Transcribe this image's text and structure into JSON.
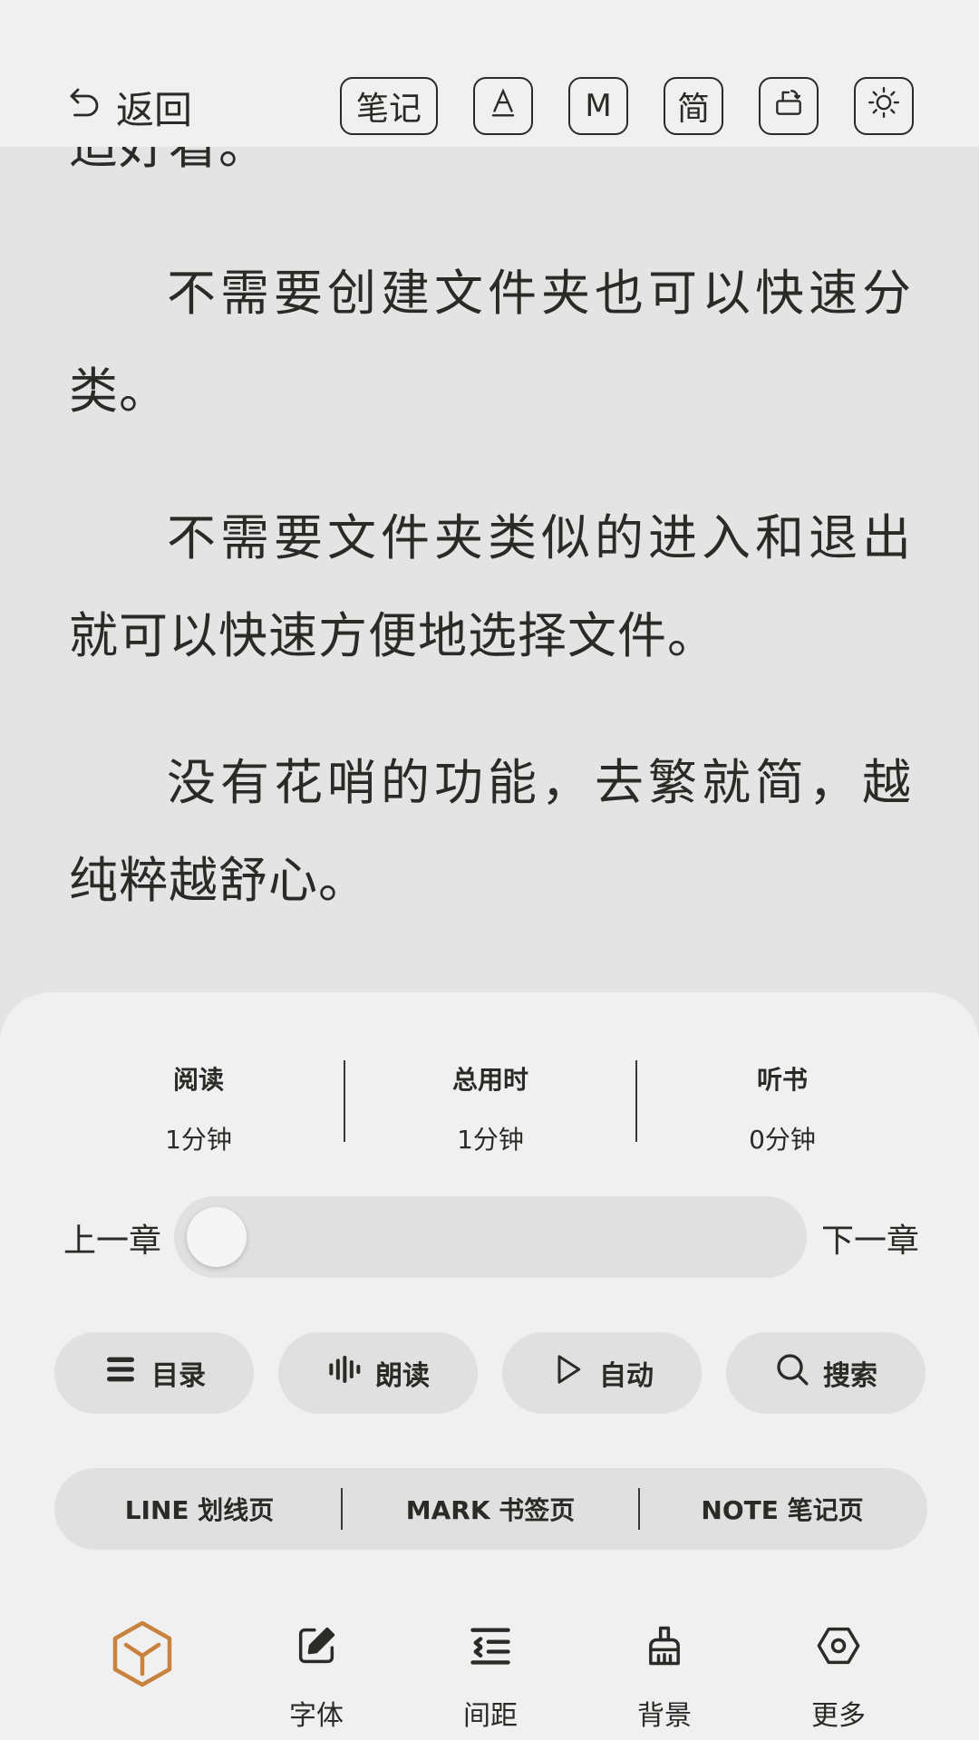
{
  "topbar": {
    "back_label": "返回",
    "note_label": "笔记",
    "m_label": "M",
    "simp_label": "简",
    "icons": [
      "back-arrow-icon",
      "font-a-icon",
      "rotate-icon",
      "brightness-icon"
    ]
  },
  "content": {
    "paragraphs": [
      "适好看。",
      "不需要创建文件夹也可以快速分类。",
      "不需要文件夹类似的进入和退出就可以快速方便地选择文件。",
      "没有花哨的功能，去繁就简，越纯粹越舒心。"
    ]
  },
  "stats": [
    {
      "label": "阅读",
      "value": "1分钟"
    },
    {
      "label": "总用时",
      "value": "1分钟"
    },
    {
      "label": "听书",
      "value": "0分钟"
    }
  ],
  "chapter": {
    "prev_label": "上一章",
    "next_label": "下一章",
    "progress": 0
  },
  "actions": [
    {
      "label": "目录",
      "icon": "list-icon"
    },
    {
      "label": "朗读",
      "icon": "waveform-icon"
    },
    {
      "label": "自动",
      "icon": "play-icon"
    },
    {
      "label": "搜索",
      "icon": "search-icon"
    }
  ],
  "pages": [
    {
      "label": "LINE 划线页"
    },
    {
      "label": "MARK 书签页"
    },
    {
      "label": "NOTE 笔记页"
    }
  ],
  "tabs": [
    {
      "label": "",
      "icon": "app-logo-icon"
    },
    {
      "label": "字体",
      "icon": "edit-icon"
    },
    {
      "label": "间距",
      "icon": "spacing-icon"
    },
    {
      "label": "背景",
      "icon": "brush-icon"
    },
    {
      "label": "更多",
      "icon": "settings-hex-icon"
    }
  ],
  "colors": {
    "accent": "#c9823d",
    "text": "#2b2a26",
    "panel": "#f0f0f0",
    "page": "#e4e4e4",
    "pill": "#e0e0e0"
  }
}
